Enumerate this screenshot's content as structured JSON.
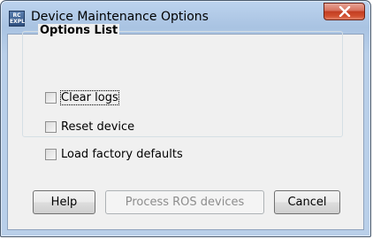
{
  "window": {
    "title": "Device Maintenance Options",
    "icon_text_line1": "RC",
    "icon_text_line2": "EXPL",
    "close_icon": "close-x-icon"
  },
  "options_group": {
    "title": "Options List",
    "items": [
      {
        "label": "Clear logs",
        "checked": false,
        "focused": true
      },
      {
        "label": "Reset device",
        "checked": false,
        "focused": false
      },
      {
        "label": "Load factory defaults",
        "checked": false,
        "focused": false
      }
    ]
  },
  "buttons": {
    "help": "Help",
    "process": "Process ROS devices",
    "process_enabled": false,
    "cancel": "Cancel"
  },
  "colors": {
    "titlebar": "#a9c3e2",
    "close_button": "#c23d22",
    "client_background": "#f0f0f0"
  }
}
